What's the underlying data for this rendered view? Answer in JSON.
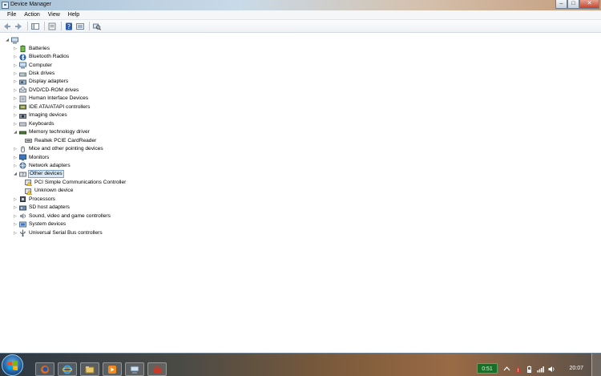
{
  "window": {
    "title": "Device Manager",
    "minimize": "–",
    "maximize": "□",
    "close": "✕"
  },
  "menu": {
    "items": [
      "File",
      "Action",
      "View",
      "Help"
    ]
  },
  "toolbar": {
    "buttons": [
      "back-arrow-icon",
      "forward-arrow-icon",
      "properties-icon",
      "show-hide-console-tree-icon",
      "help-icon",
      "update-driver-icon",
      "scan-hardware-icon"
    ]
  },
  "tree": {
    "root_icon": "computer-icon",
    "nodes": [
      {
        "label": "Batteries",
        "level": 1,
        "expander": "▷",
        "icon": "battery-icon"
      },
      {
        "label": "Bluetooth Radios",
        "level": 1,
        "expander": "▷",
        "icon": "bluetooth-icon"
      },
      {
        "label": "Computer",
        "level": 1,
        "expander": "▷",
        "icon": "computer-icon"
      },
      {
        "label": "Disk drives",
        "level": 1,
        "expander": "▷",
        "icon": "disk-drive-icon"
      },
      {
        "label": "Display adapters",
        "level": 1,
        "expander": "▷",
        "icon": "display-adapter-icon"
      },
      {
        "label": "DVD/CD-ROM drives",
        "level": 1,
        "expander": "▷",
        "icon": "dvd-drive-icon"
      },
      {
        "label": "Human Interface Devices",
        "level": 1,
        "expander": "▷",
        "icon": "hid-icon"
      },
      {
        "label": "IDE ATA/ATAPI controllers",
        "level": 1,
        "expander": "▷",
        "icon": "ide-controller-icon"
      },
      {
        "label": "Imaging devices",
        "level": 1,
        "expander": "▷",
        "icon": "camera-icon"
      },
      {
        "label": "Keyboards",
        "level": 1,
        "expander": "▷",
        "icon": "keyboard-icon"
      },
      {
        "label": "Memory technology driver",
        "level": 1,
        "expander": "◢",
        "icon": "memory-icon"
      },
      {
        "label": "Realtek PCIE CardReader",
        "level": 2,
        "expander": "",
        "icon": "card-reader-icon"
      },
      {
        "label": "Mice and other pointing devices",
        "level": 1,
        "expander": "▷",
        "icon": "mouse-icon"
      },
      {
        "label": "Monitors",
        "level": 1,
        "expander": "▷",
        "icon": "monitor-icon"
      },
      {
        "label": "Network adapters",
        "level": 1,
        "expander": "▷",
        "icon": "network-adapter-icon"
      },
      {
        "label": "Other devices",
        "level": 1,
        "expander": "◢",
        "icon": "other-devices-icon",
        "selected": true
      },
      {
        "label": "PCI Simple Communications Controller",
        "level": 2,
        "expander": "",
        "icon": "warning-device-icon"
      },
      {
        "label": "Unknown device",
        "level": 2,
        "expander": "",
        "icon": "warning-device-icon"
      },
      {
        "label": "Processors",
        "level": 1,
        "expander": "▷",
        "icon": "processor-icon"
      },
      {
        "label": "SD host adapters",
        "level": 1,
        "expander": "▷",
        "icon": "sd-host-icon"
      },
      {
        "label": "Sound, video and game controllers",
        "level": 1,
        "expander": "▷",
        "icon": "sound-icon"
      },
      {
        "label": "System devices",
        "level": 1,
        "expander": "▷",
        "icon": "system-devices-icon"
      },
      {
        "label": "Universal Serial Bus controllers",
        "level": 1,
        "expander": "▷",
        "icon": "usb-icon"
      }
    ]
  },
  "taskbar": {
    "apps": [
      "firefox-icon",
      "internet-explorer-icon",
      "windows-explorer-icon",
      "media-player-icon",
      "device-manager-icon",
      "toolbox-icon"
    ],
    "battery_text": "0:51",
    "clock": "20:07",
    "colors": {
      "battery_bg": "#1a6e2a"
    }
  }
}
